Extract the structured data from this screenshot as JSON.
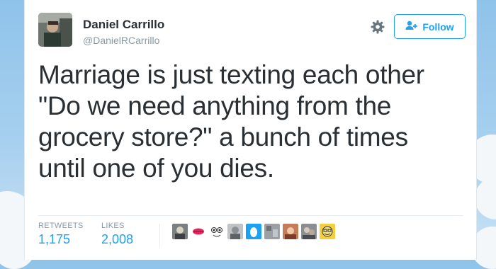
{
  "tweet": {
    "author_name": "Daniel Carrillo",
    "author_handle": "@DanielRCarrillo",
    "follow_label": "Follow",
    "text_lines": [
      "Marriage is just texting each other",
      "\"Do we need anything from the",
      "grocery store?\" a bunch of times",
      "until one of you dies."
    ],
    "retweets_label": "RETWEETS",
    "retweets_count": "1,175",
    "likes_label": "LIKES",
    "likes_count": "2,008"
  },
  "icons": {
    "gear": "gear-icon",
    "follow": "add-user-icon"
  },
  "likers": [
    "liker-avatar-1",
    "liker-avatar-lips",
    "liker-avatar-eyes",
    "liker-avatar-4",
    "liker-avatar-egg",
    "liker-avatar-6",
    "liker-avatar-7",
    "liker-avatar-8",
    "liker-avatar-9"
  ],
  "colors": {
    "accent": "#1da1f2",
    "text": "#292f33",
    "muted": "#8899a6",
    "sky": "#9ccaed"
  }
}
